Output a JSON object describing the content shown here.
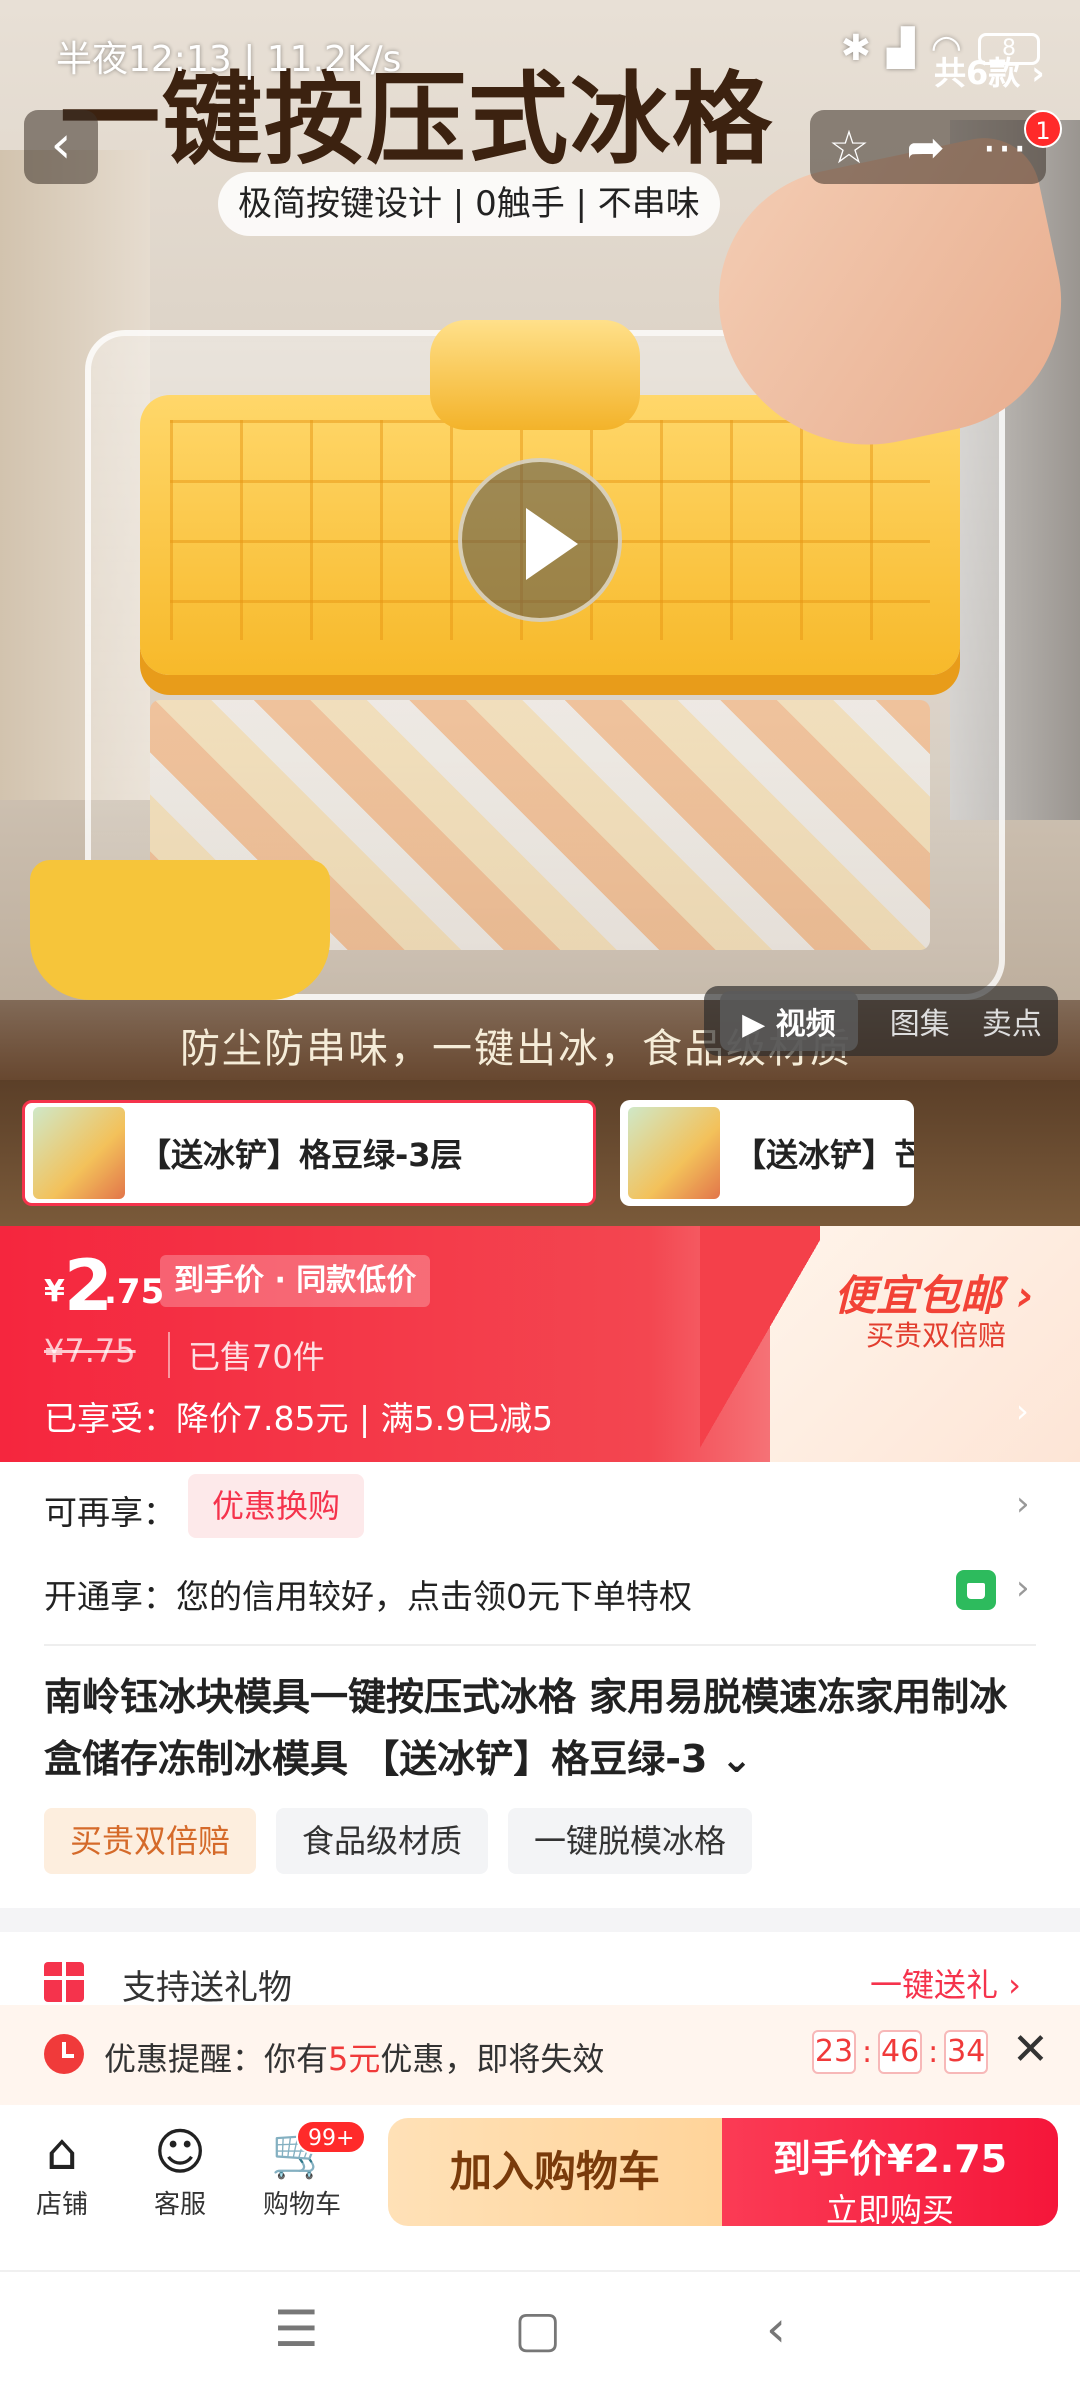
{
  "status_bar": {
    "time": "半夜12:13 | 11.2K/s",
    "battery": "8"
  },
  "hero": {
    "title": "一键按压式冰格",
    "subtitle": "极简按键设计 | 0触手 | 不串味",
    "caption": "防尘防串味，一键出冰，食品级材质",
    "media_tabs": [
      "▶ 视频",
      "图集",
      "卖点"
    ],
    "nav_badge": "1"
  },
  "variants": {
    "items": [
      "【送冰铲】格豆绿-3层",
      "【送冰铲】芒"
    ],
    "count": "共6款 ›"
  },
  "price": {
    "currency": "¥",
    "integer": "2",
    "decimal": ".75",
    "tag": "到手价 · 同款低价",
    "original": "¥7.75",
    "sold": "已售70件",
    "discount_line": "已享受：降价7.85元  |  满5.9已减5",
    "promo_title": "便宜包邮 ›",
    "promo_sub": "买贵双倍赔"
  },
  "extras": {
    "label": "可再享：",
    "tag": "优惠换购",
    "credit_text": "开通享：您的信用较好，点击领0元下单特权"
  },
  "product": {
    "title": "南岭钰冰块模具一键按压式冰格 家用易脱模速冻家用制冰盒储存冻制冰模具 【送冰铲】格豆绿-3 ⌄",
    "chips": [
      "买贵双倍赔",
      "食品级材质",
      "一键脱模冰格"
    ]
  },
  "gift": {
    "label": "支持送礼物",
    "action": "一键送礼 ›"
  },
  "reminder": {
    "prefix": "优惠提醒：你有",
    "amount": "5元",
    "suffix": "优惠，即将失效",
    "h": "23",
    "m": "46",
    "s": "34"
  },
  "bottom": {
    "store": "店铺",
    "service": "客服",
    "cart": "购物车",
    "cart_badge": "99+",
    "add_cart": "加入购物车",
    "buy_top": "到手价¥2.75",
    "buy_sub": "立即购买"
  },
  "colors": {
    "accent": "#f5334c",
    "promo": "#f24236",
    "add_cart_bg": "#ffd49a"
  }
}
